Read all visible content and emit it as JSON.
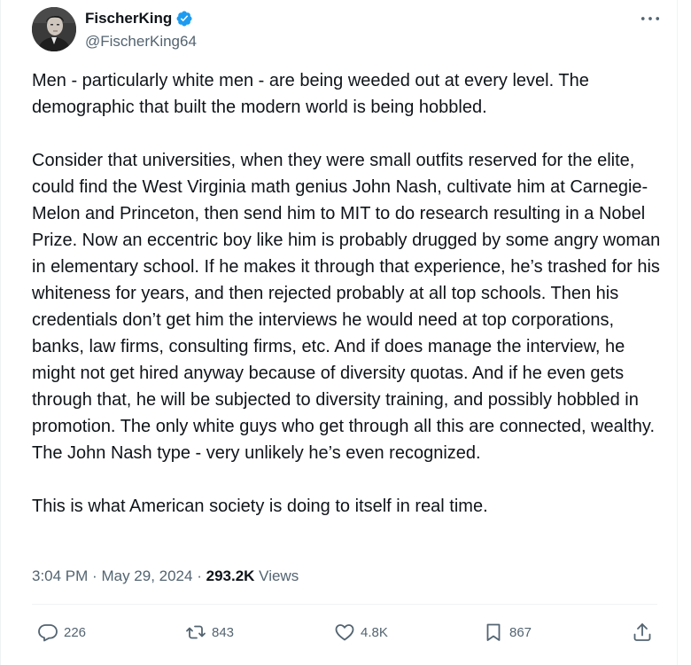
{
  "post": {
    "author": {
      "display_name": "FischerKing",
      "handle": "@FischerKing64",
      "verified": true
    },
    "paragraphs": [
      "Men - particularly white men - are being weeded out at every level. The demographic that built the modern world is being hobbled.",
      "Consider that universities, when they were small outfits reserved for the elite, could find the West Virginia math genius John Nash, cultivate him at Carnegie-Melon and Princeton, then send him to MIT to do research resulting in a Nobel Prize. Now an eccentric boy like him is probably drugged by some angry woman in elementary school. If he makes it through that experience, he’s trashed for his whiteness for years, and then rejected probably at all top schools. Then his credentials don’t get him the interviews he would need at top corporations, banks, law firms, consulting firms, etc. And if does manage the interview, he might not get hired anyway because of diversity quotas. And if he even gets through that, he will be subjected to diversity training, and possibly hobbled in promotion. The only white guys who get through all this are connected, wealthy. The John Nash type - very unlikely he’s even recognized.",
      "This is what American society is doing to itself in real time."
    ],
    "meta": {
      "time": "3:04 PM",
      "separator": "·",
      "date": "May 29, 2024",
      "views_count": "293.2K",
      "views_label": "Views"
    },
    "actions": {
      "replies": "226",
      "reposts": "843",
      "likes": "4.8K",
      "bookmarks": "867"
    }
  },
  "colors": {
    "text": "#0f1419",
    "secondary": "#536471",
    "verified": "#1d9bf0",
    "divider": "#eff3f4"
  },
  "icons": {
    "more": "more-horizontal-icon",
    "reply": "reply-icon",
    "repost": "repost-icon",
    "like": "heart-icon",
    "bookmark": "bookmark-icon",
    "share": "share-icon",
    "verified": "verified-badge-icon"
  }
}
